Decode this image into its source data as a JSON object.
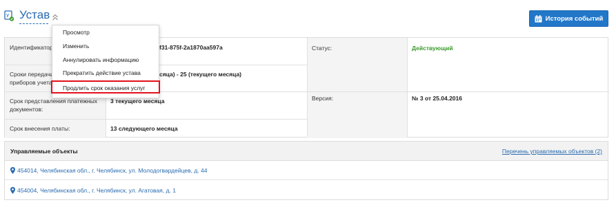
{
  "header": {
    "title": "Устав",
    "history_button": "История событий"
  },
  "info": {
    "rows": [
      {
        "label": "Идентификатор, присвоенный Г",
        "value": "f31-875f-2a1870aa597a"
      },
      {
        "label": "Сроки передачи показаний приборов учета:",
        "value": "сяца) - 25 (текущего месяца)"
      },
      {
        "label": "Срок представления платежных документов:",
        "value": "3 текущего месяца"
      },
      {
        "label": "Срок внесения платы:",
        "value": "13 следующего месяца"
      }
    ],
    "status_label": "Статус:",
    "status_value": "Действующий",
    "version_label": "Версия:",
    "version_value": "№ 3 от 25.04.2016"
  },
  "objects": {
    "title": "Управляемые объекты",
    "link": "Перечень управляемых объектов (2)",
    "items": [
      "454014, Челябинская обл., г. Челябинск, ул. Молодогвардейцев, д. 44",
      "454004, Челябинская обл., г. Челябинск, ул. Агатовая, д. 1"
    ]
  },
  "menu": {
    "items": [
      "Просмотр",
      "Изменить",
      "Аннулировать информацию",
      "Прекратить действие устава",
      "Продлить срок оказания услуг"
    ]
  },
  "colors": {
    "accent": "#2a6bb0",
    "button": "#2277c9",
    "status_green": "#3a9a2a",
    "highlight_red": "#e0101a"
  }
}
